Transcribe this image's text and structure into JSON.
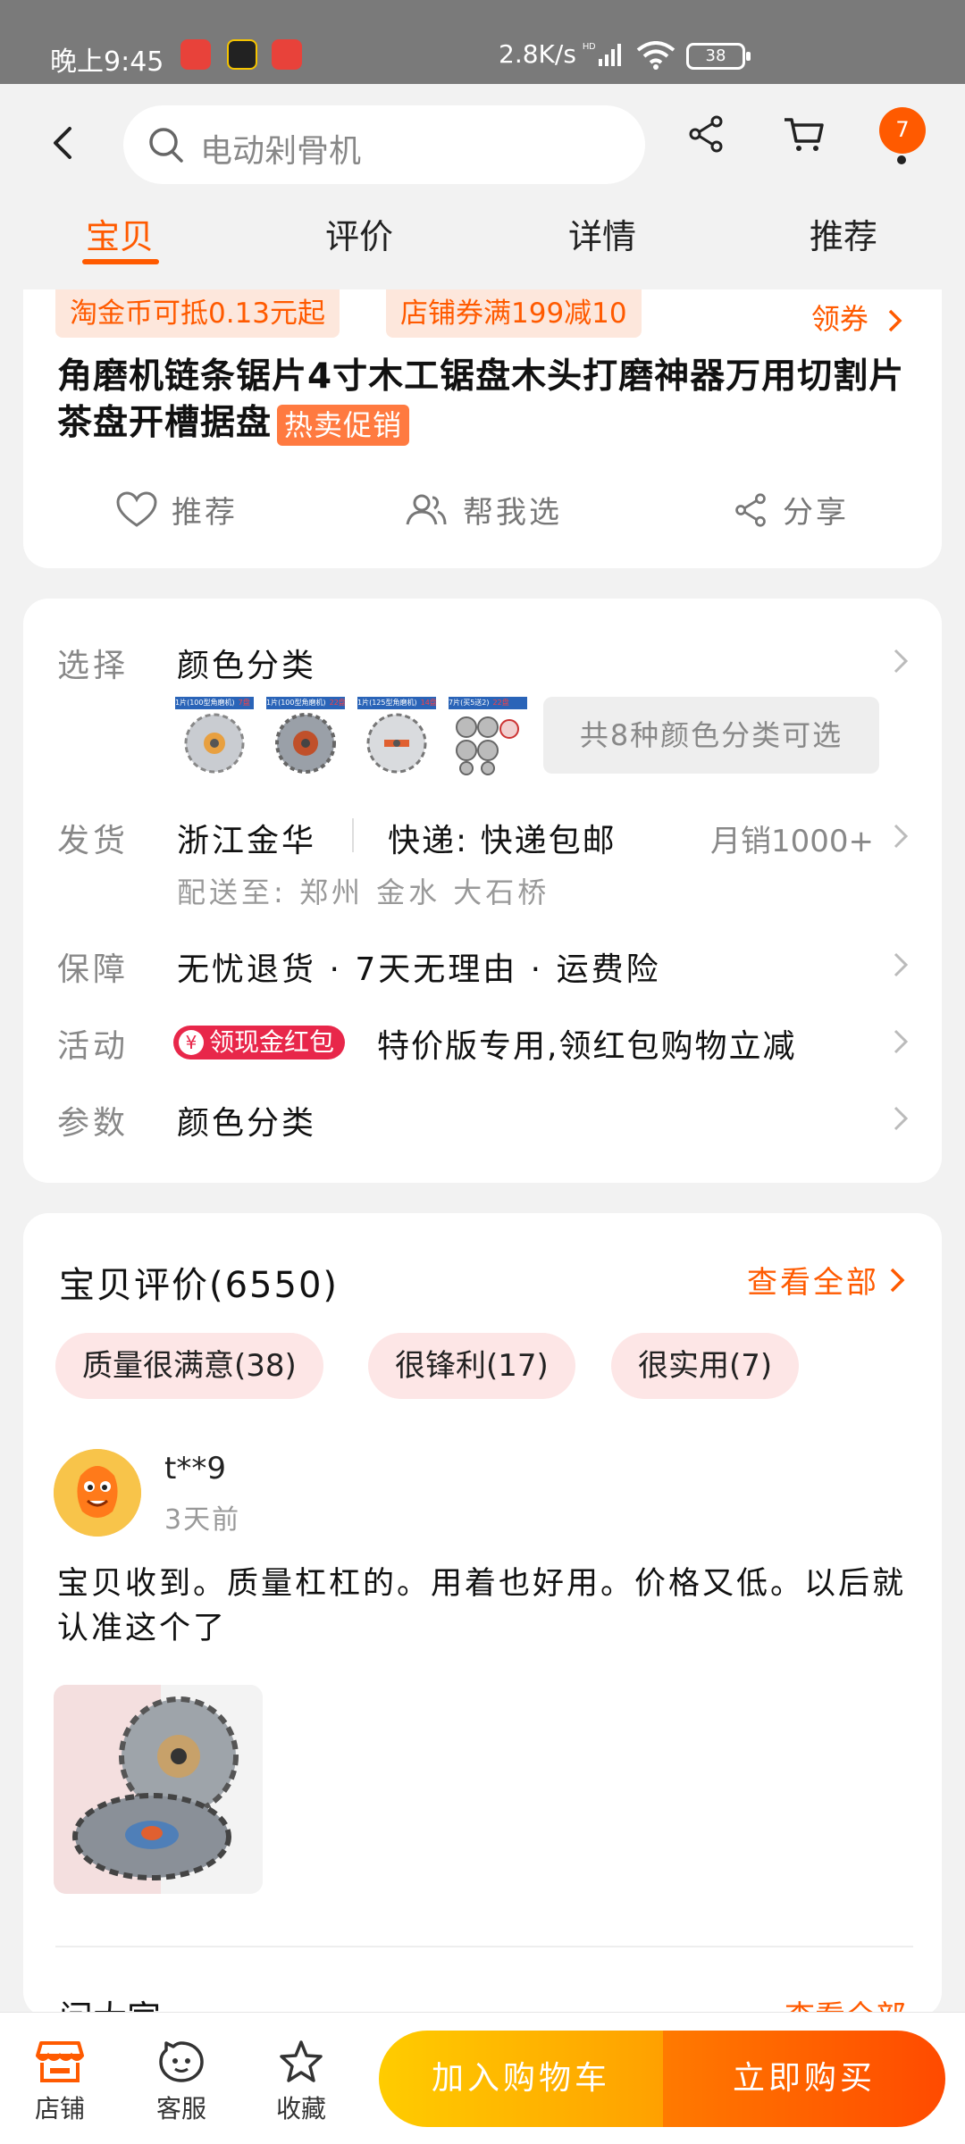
{
  "status_bar": {
    "time": "晚上9:45",
    "network_speed": "2.8K/s",
    "battery": "38"
  },
  "header": {
    "search_placeholder": "电动剁骨机",
    "cart_badge": "7",
    "tabs": [
      "宝贝",
      "评价",
      "详情",
      "推荐"
    ]
  },
  "product": {
    "coupons": [
      "淘金币可抵0.13元起",
      "店铺券满199减10"
    ],
    "coupon_link": "领券",
    "title": "角磨机链条锯片4寸木工锯盘木头打磨神器万用切割片茶盘开槽据盘",
    "hot_tag": "热卖促销",
    "actions": {
      "recommend": "推荐",
      "help_choose": "帮我选",
      "share": "分享"
    }
  },
  "spec": {
    "select": {
      "label": "选择",
      "value": "颜色分类",
      "more": "共8种颜色分类可选"
    },
    "thumb_tags": [
      {
        "text": "1片(100型角磨机)",
        "price": "7盘"
      },
      {
        "text": "1片(100型角磨机)",
        "price": "22盘"
      },
      {
        "text": "1片(125型角磨机)",
        "price": "14盘"
      },
      {
        "text": "7片(买5送2)",
        "price": "22盘"
      }
    ],
    "ship": {
      "label": "发货",
      "origin": "浙江金华",
      "method": "快递: 快递包邮",
      "sold": "月销1000+",
      "deliver": "配送至: 郑州 金水 大石桥"
    },
    "guarantee": {
      "label": "保障",
      "value": "无忧退货 · 7天无理由 · 运费险"
    },
    "activity": {
      "label": "活动",
      "badge": "领现金红包",
      "yen": "¥",
      "value": "特价版专用,领红包购物立减"
    },
    "params": {
      "label": "参数",
      "value": "颜色分类"
    }
  },
  "reviews": {
    "title": "宝贝评价(6550)",
    "view_all": "查看全部",
    "tags": [
      "质量很满意(38)",
      "很锋利(17)",
      "很实用(7)"
    ],
    "item": {
      "user": "t**9",
      "time": "3天前",
      "text": "宝贝收到。质量杠杠的。用着也好用。价格又低。以后就认准这个了"
    },
    "qa_title": "问大家",
    "qa_all": "查看全部"
  },
  "bottom": {
    "shop": "店铺",
    "service": "客服",
    "favorite": "收藏",
    "add_cart": "加入购物车",
    "buy_now": "立即购买"
  },
  "colors": {
    "accent": "#ff5a00",
    "coupon_bg": "#fde7dc",
    "pill_bg": "#fde6e6",
    "redpacket": "#e8274a"
  }
}
